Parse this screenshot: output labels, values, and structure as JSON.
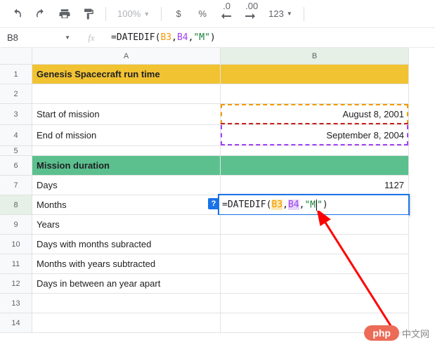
{
  "toolbar": {
    "zoom": "100%",
    "currency": "$",
    "percent": "%",
    "dec_less": ".0",
    "dec_more": ".00",
    "num123": "123"
  },
  "namebox": {
    "cell": "B8",
    "fx": "fx"
  },
  "formula": {
    "eq": "=",
    "fn": "DATEDIF",
    "open": "(",
    "ref1": "B3",
    "comma1": ", ",
    "ref2": "B4",
    "comma2": ",",
    "str": "\"M\"",
    "close": ")"
  },
  "columns": {
    "A": "A",
    "B": "B"
  },
  "rows": {
    "r1": "1",
    "r2": "2",
    "r3": "3",
    "r4": "4",
    "r5": "5",
    "r6": "6",
    "r7": "7",
    "r8": "8",
    "r9": "9",
    "r10": "10",
    "r11": "11",
    "r12": "12",
    "r13": "13",
    "r14": "14"
  },
  "cells": {
    "a1": "Genesis Spacecraft run time",
    "a3": "Start of mission",
    "b3": "August 8, 2001",
    "a4": "End of mission",
    "b4": "September 8, 2004",
    "a6": "Mission duration",
    "a7": "Days",
    "b7": "1127",
    "a8": "Months",
    "a9": "Years",
    "a10": "Days with months subracted",
    "a11": "Months with years subtracted",
    "a12": "Days in between an year apart"
  },
  "hint": "?",
  "watermark": {
    "brand": "php",
    "text": "中文网"
  }
}
